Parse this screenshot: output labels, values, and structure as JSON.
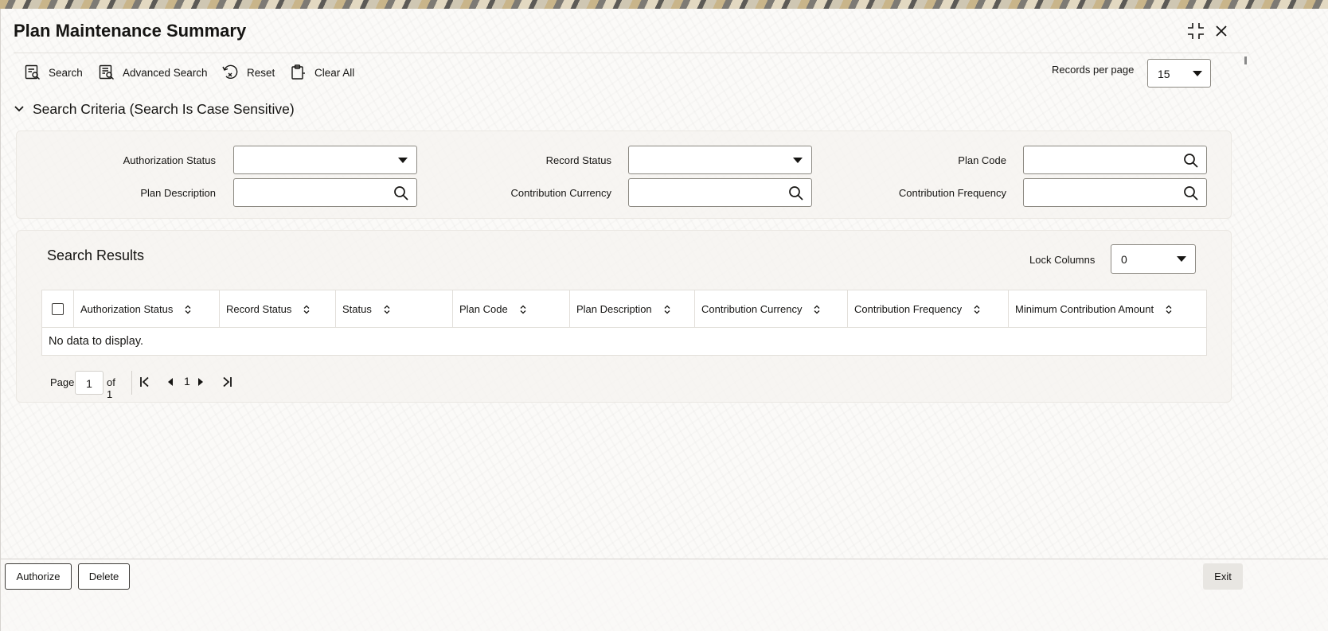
{
  "window": {
    "title": "Plan Maintenance Summary"
  },
  "toolbar": {
    "search_label": "Search",
    "advanced_search_label": "Advanced Search",
    "reset_label": "Reset",
    "clear_all_label": "Clear All",
    "records_per_page_label": "Records per page",
    "records_per_page_value": "15"
  },
  "criteria": {
    "heading": "Search Criteria (Search Is Case Sensitive)",
    "fields": {
      "authorization_status": {
        "label": "Authorization Status",
        "value": ""
      },
      "record_status": {
        "label": "Record Status",
        "value": ""
      },
      "plan_code": {
        "label": "Plan Code",
        "value": ""
      },
      "plan_description": {
        "label": "Plan Description",
        "value": ""
      },
      "contribution_currency": {
        "label": "Contribution Currency",
        "value": ""
      },
      "contribution_frequency": {
        "label": "Contribution Frequency",
        "value": ""
      }
    }
  },
  "results": {
    "title": "Search Results",
    "lock_columns_label": "Lock Columns",
    "lock_columns_value": "0",
    "columns": [
      "Authorization Status",
      "Record Status",
      "Status",
      "Plan Code",
      "Plan Description",
      "Contribution Currency",
      "Contribution Frequency",
      "Minimum Contribution Amount"
    ],
    "empty_message": "No data to display."
  },
  "pager": {
    "page_label": "Page",
    "page_value": "1",
    "of_label": "of 1",
    "current_page": "1"
  },
  "footer": {
    "authorize_label": "Authorize",
    "delete_label": "Delete",
    "exit_label": "Exit"
  }
}
